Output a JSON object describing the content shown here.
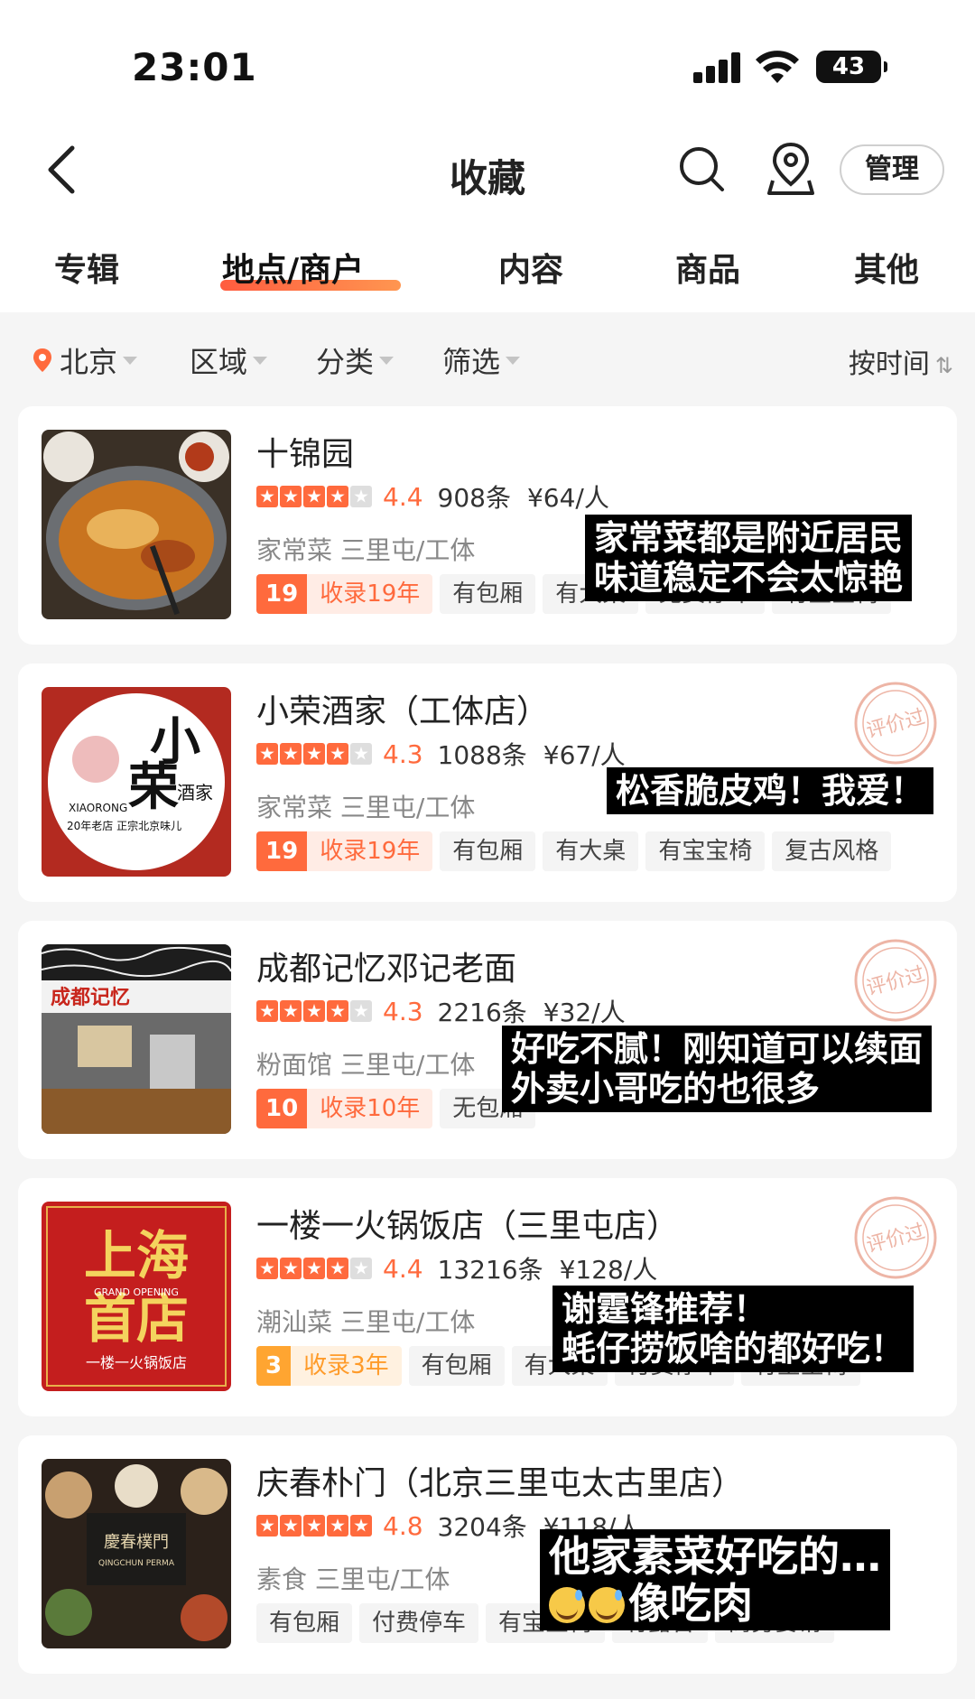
{
  "status_bar": {
    "time": "23:01",
    "battery": "43"
  },
  "header": {
    "title": "收藏",
    "manage_label": "管理"
  },
  "tabs": [
    {
      "label": "专辑"
    },
    {
      "label": "地点/商户",
      "active": true
    },
    {
      "label": "内容"
    },
    {
      "label": "商品"
    },
    {
      "label": "其他"
    }
  ],
  "filters": {
    "city": "北京",
    "area": "区域",
    "category": "分类",
    "filter": "筛选",
    "sort": "按时间",
    "sort_icon": "⇅"
  },
  "colors": {
    "accent": "#ff6a3d",
    "badge_orange": "#ffa531"
  },
  "stamp_text": "评价过",
  "places": [
    {
      "name": "十锦园",
      "stars": 4,
      "score": "4.4",
      "reviews": "908条",
      "price": "¥64/人",
      "category": "家常菜 三里屯/工体",
      "badge_num": "19",
      "badge_label": "收录19年",
      "tags": [
        "有包厢",
        "有大桌",
        "免费停车",
        "有宝宝椅"
      ],
      "caption": [
        "家常菜都是附近居民",
        "味道稳定不会太惊艳"
      ],
      "thumb": "hotpot"
    },
    {
      "name": "小荣酒家（工体店）",
      "stars": 4,
      "score": "4.3",
      "reviews": "1088条",
      "price": "¥67/人",
      "category": "家常菜 三里屯/工体",
      "badge_num": "19",
      "badge_label": "收录19年",
      "tags": [
        "有包厢",
        "有大桌",
        "有宝宝椅",
        "复古风格"
      ],
      "caption": [
        "松香脆皮鸡！我爱！"
      ],
      "thumb": "logo",
      "logo_text": {
        "big1": "小",
        "big2": "荣",
        "small": "酒家",
        "en": "XIAORONG",
        "sub": "20年老店 正宗北京味儿"
      }
    },
    {
      "name": "成都记忆邓记老面",
      "stars": 4,
      "score": "4.3",
      "reviews": "2216条",
      "price": "¥32/人",
      "category": "粉面馆 三里屯/工体",
      "badge_num": "10",
      "badge_label": "收录10年",
      "tags": [
        "无包厢"
      ],
      "caption": [
        "好吃不腻！刚知道可以续面",
        "外卖小哥吃的也很多"
      ],
      "thumb": "shopfront",
      "sign_text": "成都记忆"
    },
    {
      "name": "一楼一火锅饭店（三里屯店）",
      "stars": 4,
      "score": "4.4",
      "reviews": "13216条",
      "price": "¥128/人",
      "category": "潮汕菜 三里屯/工体",
      "badge_num": "3",
      "badge_label": "收录3年",
      "badge_style": "orange",
      "tags": [
        "有包厢",
        "有大桌",
        "付费停车",
        "有宝宝椅"
      ],
      "caption": [
        "谢霆锋推荐！",
        "蚝仔捞饭啥的都好吃！"
      ],
      "thumb": "poster",
      "poster_text": {
        "line1": "上海",
        "line2": "首店",
        "en": "GRAND OPENING",
        "bottom": "一楼一火锅饭店"
      }
    },
    {
      "name": "庆春朴门（北京三里屯太古里店）",
      "stars": 5,
      "score": "4.8",
      "reviews": "3204条",
      "price": "¥118/人",
      "category": "素食 三里屯/工体",
      "tags": [
        "有包厢",
        "付费停车",
        "有宝宝椅",
        "有露台",
        "商务宴请"
      ],
      "caption": [
        "他家素菜好吃的…",
        "像吃肉"
      ],
      "thumb": "dishes",
      "dish_text": {
        "cn": "慶春樸門",
        "en": "QINGCHUN PERMA"
      }
    }
  ]
}
